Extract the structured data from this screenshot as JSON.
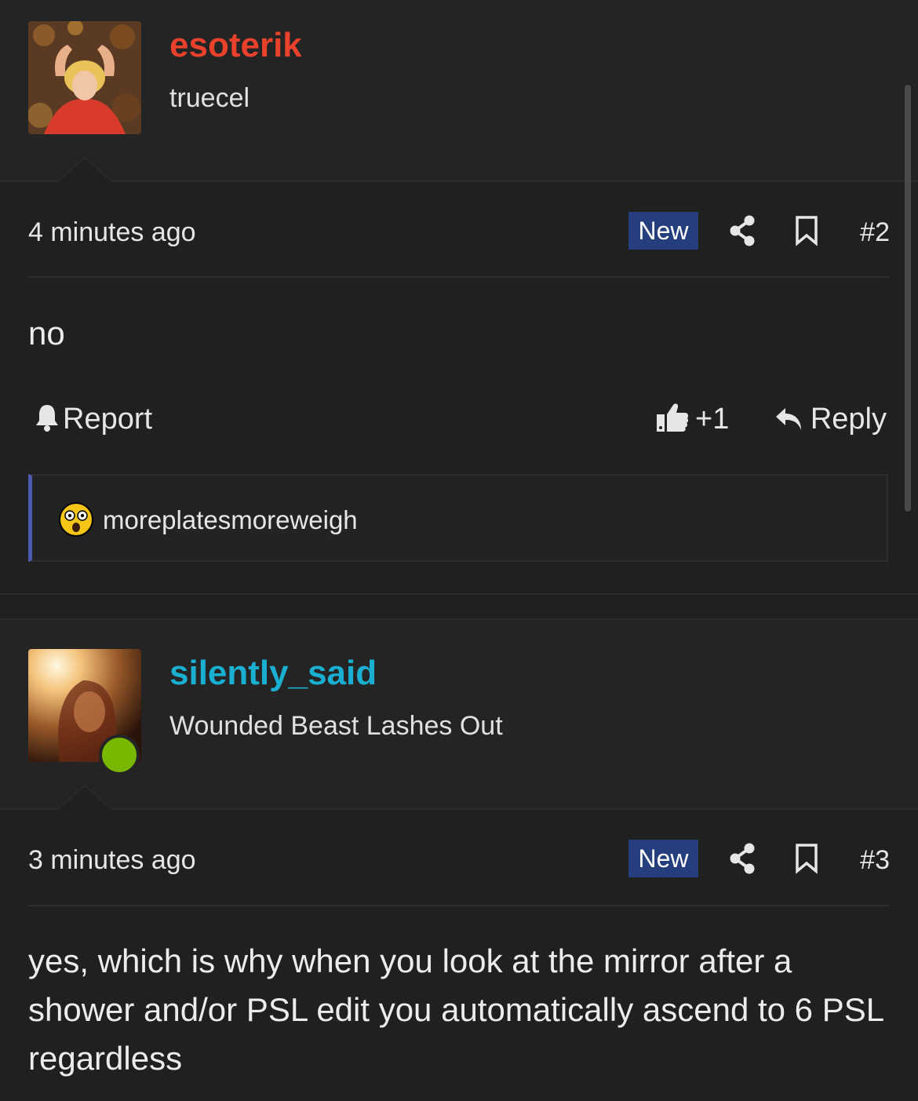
{
  "posts": [
    {
      "username": "esoterik",
      "username_color": "#e8412c",
      "user_title": "truecel",
      "time": "4 minutes ago",
      "badge": "New",
      "post_number": "#2",
      "body": "no",
      "actions": {
        "report": "Report",
        "like_count": "+1",
        "reply": "Reply"
      },
      "reactions": {
        "emoji": "astonished-face",
        "users": "moreplatesmoreweigh"
      }
    },
    {
      "username": "silently_said",
      "username_color": "#1aaed0",
      "user_title": "Wounded Beast Lashes Out",
      "online": true,
      "time": "3 minutes ago",
      "badge": "New",
      "post_number": "#3",
      "body": "yes, which is why when you look at the mirror after a shower and/or PSL edit you automatically ascend to 6 PSL regardless"
    }
  ],
  "colors": {
    "badge_bg": "#253e7e",
    "online": "#7ab800",
    "reaction_accent": "#4a5bb0"
  }
}
